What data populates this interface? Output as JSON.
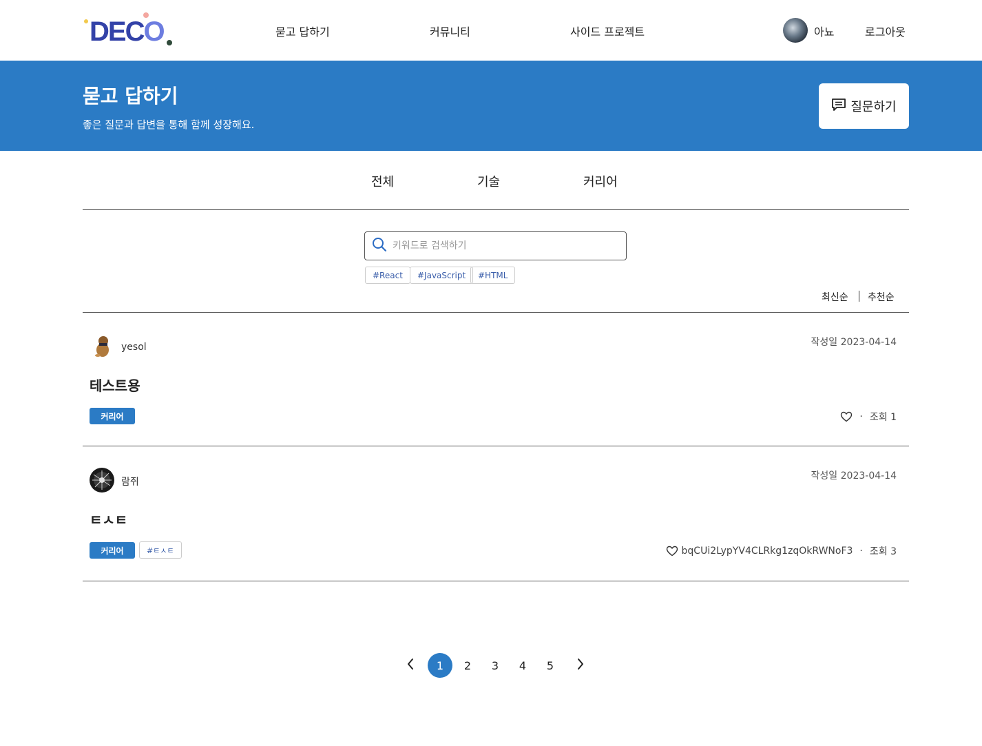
{
  "header": {
    "logo_text": "DECO",
    "nav": [
      "묻고 답하기",
      "커뮤니티",
      "사이드 프로젝트"
    ],
    "user_name": "아뇨",
    "logout_label": "로그아웃"
  },
  "banner": {
    "title": "묻고 답하기",
    "subtitle": "좋은 질문과 답변을 통해 함께 성장해요.",
    "ask_button_label": "질문하기"
  },
  "categories": [
    "전체",
    "기술",
    "커리어"
  ],
  "search": {
    "placeholder": "키워드로 검색하기",
    "value": "",
    "tags": [
      "#React",
      "#JavaScript",
      "#HTML"
    ]
  },
  "sort": {
    "options": [
      "최신순",
      "추천순"
    ]
  },
  "posts": [
    {
      "author": "yesol",
      "date": "작성일 2023-04-14",
      "title": "테스트용",
      "category": "커리어",
      "tags": [],
      "likes": "",
      "views": "조회 1"
    },
    {
      "author": "람쥐",
      "date": "작성일 2023-04-14",
      "title": "ㅌㅅㅌ",
      "category": "커리어",
      "tags": [
        "#ㅌㅅㅌ"
      ],
      "likes": "bqCUi2LypYV4CLRkg1zqOkRWNoF3",
      "views": "조회 3"
    }
  ],
  "pagination": {
    "pages": [
      "1",
      "2",
      "3",
      "4",
      "5"
    ],
    "current": "1"
  },
  "colors": {
    "accent": "#2b7bc5",
    "logo": "#3342a8",
    "tag_text": "#3a5eaa"
  }
}
